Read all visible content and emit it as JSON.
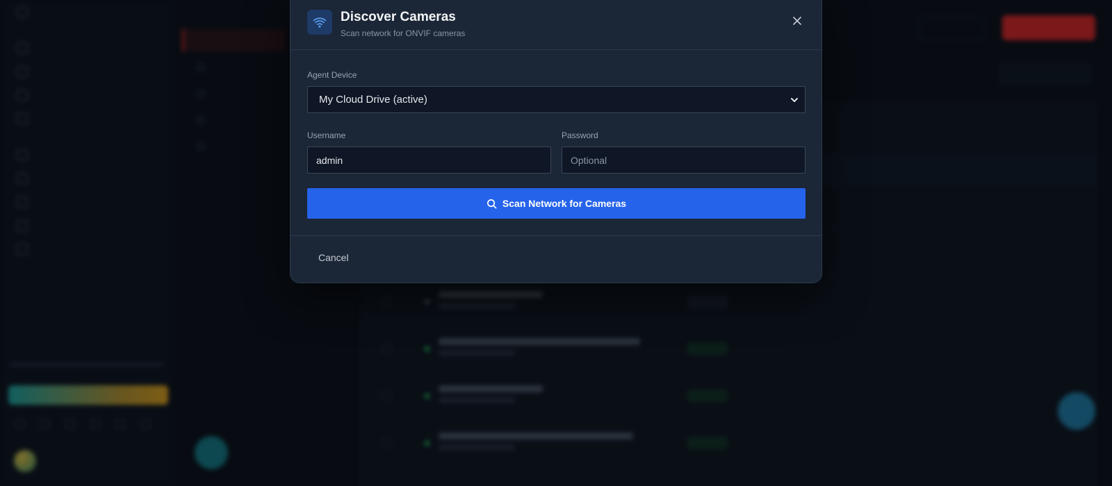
{
  "modal": {
    "title": "Discover Cameras",
    "subtitle": "Scan network for ONVIF cameras",
    "agent_device": {
      "label": "Agent Device",
      "selected": "My Cloud Drive (active)"
    },
    "username": {
      "label": "Username",
      "value": "admin"
    },
    "password": {
      "label": "Password",
      "placeholder": "Optional"
    },
    "scan_button_label": "Scan Network for Cameras",
    "cancel_label": "Cancel",
    "icons": {
      "header": "wifi-icon",
      "close": "close-icon",
      "scan": "search-icon",
      "select": "chevron-down-icon"
    },
    "colors": {
      "primary": "#2563eb",
      "modal_bg": "#1b2636",
      "accent_danger": "#dc2626"
    }
  }
}
